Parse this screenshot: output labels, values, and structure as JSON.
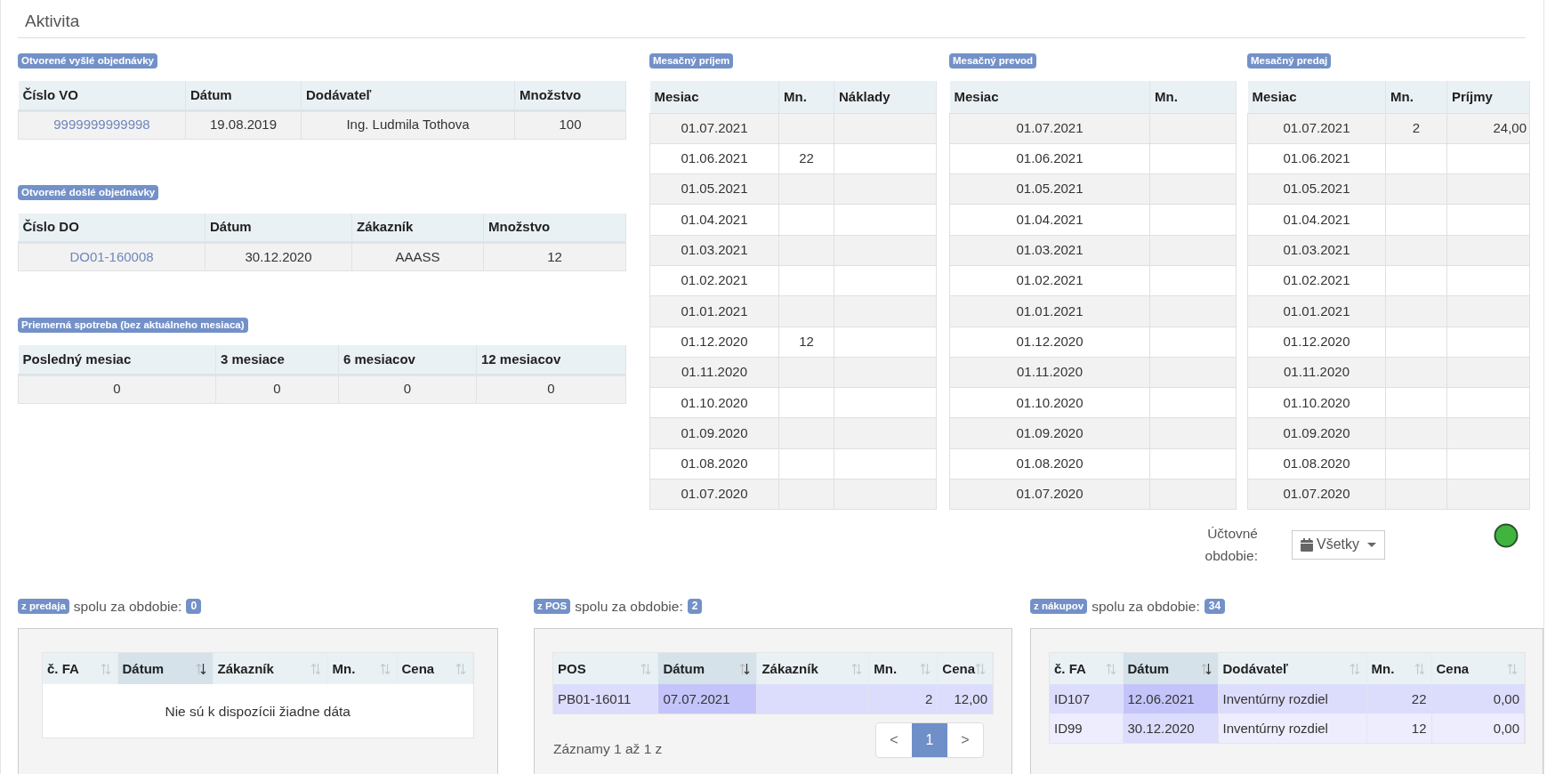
{
  "title": "Aktivita",
  "orders": [
    {
      "badge": "Otvorené vyšlé objednávky",
      "columns": [
        "Číslo VO",
        "Dátum",
        "Dodávateľ",
        "Množstvo"
      ],
      "rows": [
        [
          "9999999999998",
          "19.08.2019",
          "Ing. Ludmila Tothova",
          "100"
        ]
      ]
    },
    {
      "badge": "Otvorené došlé objednávky",
      "columns": [
        "Číslo DO",
        "Dátum",
        "Zákazník",
        "Množstvo"
      ],
      "rows": [
        [
          "DO01-160008",
          "30.12.2020",
          "AAASS",
          "12"
        ]
      ]
    }
  ],
  "consumption": {
    "badge": "Priemerná spotreba (bez aktuálneho mesiaca)",
    "columns": [
      "Posledný mesiac",
      "3 mesiace",
      "6 mesiacov",
      "12 mesiacov"
    ],
    "rows": [
      [
        "0",
        "0",
        "0",
        "0"
      ]
    ]
  },
  "monthly": [
    {
      "badge": "Mesačný príjem",
      "columns": [
        "Mesiac",
        "Mn.",
        "Náklady"
      ],
      "rows": [
        {
          "month": "01.07.2021"
        },
        {
          "month": "01.06.2021",
          "qty": "22"
        },
        {
          "month": "01.05.2021"
        },
        {
          "month": "01.04.2021"
        },
        {
          "month": "01.03.2021"
        },
        {
          "month": "01.02.2021"
        },
        {
          "month": "01.01.2021"
        },
        {
          "month": "01.12.2020",
          "qty": "12"
        },
        {
          "month": "01.11.2020"
        },
        {
          "month": "01.10.2020"
        },
        {
          "month": "01.09.2020"
        },
        {
          "month": "01.08.2020"
        },
        {
          "month": "01.07.2020"
        }
      ]
    },
    {
      "badge": "Mesačný prevod",
      "columns": [
        "Mesiac",
        "Mn."
      ],
      "rows": [
        {
          "month": "01.07.2021"
        },
        {
          "month": "01.06.2021"
        },
        {
          "month": "01.05.2021"
        },
        {
          "month": "01.04.2021"
        },
        {
          "month": "01.03.2021"
        },
        {
          "month": "01.02.2021"
        },
        {
          "month": "01.01.2021"
        },
        {
          "month": "01.12.2020"
        },
        {
          "month": "01.11.2020"
        },
        {
          "month": "01.10.2020"
        },
        {
          "month": "01.09.2020"
        },
        {
          "month": "01.08.2020"
        },
        {
          "month": "01.07.2020"
        }
      ]
    },
    {
      "badge": "Mesačný predaj",
      "columns": [
        "Mesiac",
        "Mn.",
        "Príjmy"
      ],
      "rows": [
        {
          "month": "01.07.2021",
          "qty": "2",
          "amount": "24,00"
        },
        {
          "month": "01.06.2021"
        },
        {
          "month": "01.05.2021"
        },
        {
          "month": "01.04.2021"
        },
        {
          "month": "01.03.2021"
        },
        {
          "month": "01.02.2021"
        },
        {
          "month": "01.01.2021"
        },
        {
          "month": "01.12.2020"
        },
        {
          "month": "01.11.2020"
        },
        {
          "month": "01.10.2020"
        },
        {
          "month": "01.09.2020"
        },
        {
          "month": "01.08.2020"
        },
        {
          "month": "01.07.2020"
        }
      ]
    }
  ],
  "period": {
    "label": "Účtovné obdobie:",
    "value": "Všetky"
  },
  "summaries": [
    {
      "badge": "z predaja",
      "text": "spolu za obdobie:",
      "count": "0",
      "columns": [
        {
          "label": "č. FA",
          "sorted": false
        },
        {
          "label": "Dátum",
          "sorted": true
        },
        {
          "label": "Zákazník",
          "sorted": false
        },
        {
          "label": "Mn.",
          "sorted": false
        },
        {
          "label": "Cena",
          "sorted": false
        }
      ],
      "empty_message": "Nie sú k dispozícii žiadne dáta"
    },
    {
      "badge": "z POS",
      "text": "spolu za obdobie:",
      "count": "2",
      "columns": [
        {
          "label": "POS",
          "sorted": false
        },
        {
          "label": "Dátum",
          "sorted": true
        },
        {
          "label": "Zákazník",
          "sorted": false
        },
        {
          "label": "Mn.",
          "sorted": false
        },
        {
          "label": "Cena",
          "sorted": false
        }
      ],
      "rows": [
        {
          "number": "PB01-16011",
          "date": "07.07.2021",
          "qty": "2",
          "price": "12,00"
        }
      ],
      "info": "Záznamy 1 až 1 z",
      "pagination": {
        "prev": "<",
        "next": ">",
        "pages": [
          {
            "label": "1",
            "selected": true
          }
        ]
      }
    },
    {
      "badge": "z nákupov",
      "text": "spolu za obdobie:",
      "count": "34",
      "columns": [
        {
          "label": "č. FA",
          "sorted": false
        },
        {
          "label": "Dátum",
          "sorted": true
        },
        {
          "label": "Dodávateľ",
          "sorted": false
        },
        {
          "label": "Mn.",
          "sorted": false
        },
        {
          "label": "Cena",
          "sorted": false
        }
      ],
      "rows": [
        {
          "number": "ID107",
          "date": "12.06.2021",
          "partner": "Inventúrny rozdiel",
          "qty": "22",
          "price": "0,00"
        },
        {
          "number": "ID99",
          "date": "30.12.2020",
          "partner": "Inventúrny rozdiel",
          "qty": "12",
          "price": "0,00"
        }
      ]
    }
  ]
}
